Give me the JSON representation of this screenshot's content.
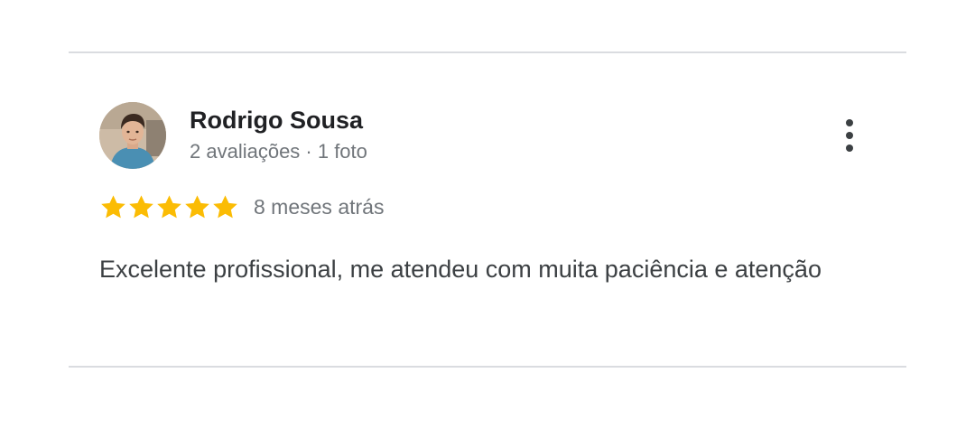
{
  "review": {
    "reviewer": {
      "name": "Rodrigo Sousa",
      "meta": "2 avaliações · 1 foto",
      "avatar_icon": "avatar-photo"
    },
    "more_options_icon": "more-vert-icon",
    "rating": {
      "stars": 5,
      "max_stars": 5,
      "star_color": "#fbbc04",
      "time": "8 meses atrás"
    },
    "text": "Excelente profissional, me atendeu com muita paciência e atenção"
  },
  "colors": {
    "divider": "#dadce0",
    "name": "#202124",
    "secondary": "#70757a",
    "body_text": "#3c4043"
  }
}
